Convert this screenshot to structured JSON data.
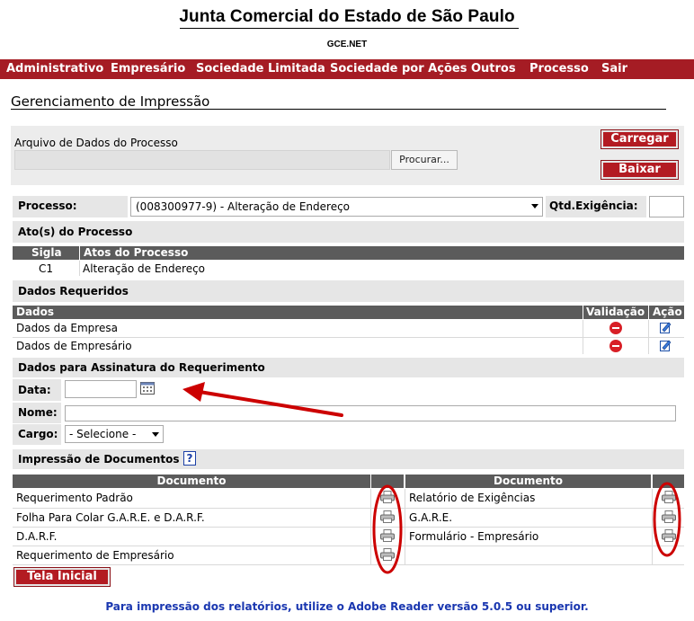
{
  "header": {
    "title": "Junta Comercial do Estado de São Paulo",
    "subtitle": "GCE.NET"
  },
  "menu": {
    "items": [
      "Administrativo",
      "Empresário",
      "Sociedade Limitada",
      "Sociedade por Ações",
      "Outros",
      "Processo",
      "Sair"
    ]
  },
  "page": {
    "heading": "Gerenciamento de Impressão"
  },
  "upload": {
    "label": "Arquivo de Dados do Processo",
    "file_value": "",
    "browse_label": "Procurar...",
    "load_label": "Carregar",
    "download_label": "Baixar"
  },
  "process": {
    "label": "Processo:",
    "selected": "(008300977-9) - Alteração de Endereço",
    "qtd_label": "Qtd.Exigência:",
    "qtd_value": ""
  },
  "acts": {
    "section_title": "Ato(s) do Processo",
    "columns": [
      "Sigla",
      "Atos do Processo"
    ],
    "rows": [
      {
        "sigla": "C1",
        "ato": "Alteração de Endereço"
      }
    ]
  },
  "required_data": {
    "section_title": "Dados Requeridos",
    "columns": [
      "Dados",
      "Validação",
      "Ação"
    ],
    "rows": [
      {
        "label": "Dados da Empresa",
        "validation_icon": "invalid-icon",
        "action_icon": "edit-icon"
      },
      {
        "label": "Dados de Empresário",
        "validation_icon": "invalid-icon",
        "action_icon": "edit-icon"
      }
    ]
  },
  "signature": {
    "section_title": "Dados para Assinatura do Requerimento",
    "date_label": "Data:",
    "date_value": "",
    "name_label": "Nome:",
    "name_value": "",
    "cargo_label": "Cargo:",
    "cargo_selected": "- Selecione -"
  },
  "printing": {
    "section_title": "Impressão de Documentos",
    "help_glyph": "?",
    "column_label": "Documento",
    "left_docs": [
      "Requerimento Padrão",
      "Folha Para Colar G.A.R.E. e D.A.R.F.",
      "D.A.R.F.",
      "Requerimento de Empresário"
    ],
    "right_docs": [
      "Relatório de Exigências",
      "G.A.R.E.",
      "Formulário - Empresário"
    ]
  },
  "footer": {
    "home_label": "Tela Inicial",
    "note": "Para impressão dos relatórios, utilize o Adobe Reader versão 5.0.5 ou superior."
  },
  "colors": {
    "menu_bar": "#a51c24",
    "buttons": "#b31b22",
    "section_bar": "#e6e6e6",
    "table_header": "#5b5b5b",
    "annotation": "#cc0000",
    "footer_note": "#1a37b0"
  }
}
